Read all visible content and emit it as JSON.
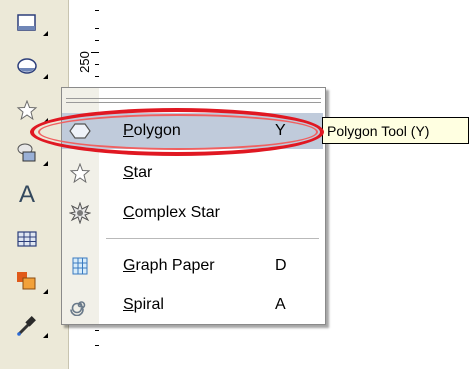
{
  "toolbox": {
    "tools": [
      {
        "name": "rectangle-tool-icon"
      },
      {
        "name": "ellipse-tool-icon"
      },
      {
        "name": "polygon-star-tool-icon"
      },
      {
        "name": "basic-shapes-tool-icon"
      },
      {
        "name": "text-tool-icon",
        "glyph": "A"
      },
      {
        "name": "table-tool-icon"
      },
      {
        "name": "interactive-tool-icon"
      },
      {
        "name": "eyedropper-tool-icon"
      }
    ]
  },
  "ruler": {
    "label": "250"
  },
  "menu": {
    "items": [
      {
        "label_underline": "P",
        "label_rest": "olygon",
        "shortcut": "Y",
        "highlighted": true
      },
      {
        "label_underline": "S",
        "label_rest": "tar",
        "shortcut": ""
      },
      {
        "label_underline": "C",
        "label_rest": "omplex Star",
        "shortcut": ""
      },
      {
        "label_underline": "G",
        "label_rest": "raph Paper",
        "shortcut": "D"
      },
      {
        "label_underline": "S",
        "label_rest": "piral",
        "shortcut": "A"
      }
    ]
  },
  "tooltip": {
    "text": "Polygon Tool (Y)"
  },
  "colors": {
    "annotation": "#e01822",
    "highlight": "#c0cbdb",
    "toolbox_bg": "#ece9d8",
    "tooltip_bg": "#ffffe1"
  }
}
